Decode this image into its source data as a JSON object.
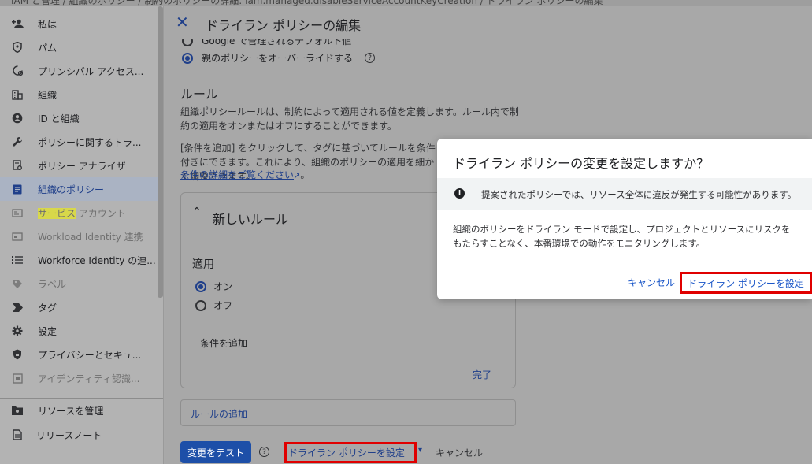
{
  "breadcrumb": "IAM と管理 / 組織のポリシー / 制約のポリシーの詳細: iam.managed.disableServiceAccountKeyCreation / ドライラン ポリシーの編集",
  "sidebar": {
    "items": [
      {
        "label": "私は",
        "icon": "person-add-icon"
      },
      {
        "label": "パム",
        "icon": "shield-icon"
      },
      {
        "label": "プリンシパル アクセス...",
        "icon": "access-icon"
      },
      {
        "label": "組織",
        "icon": "building-icon"
      },
      {
        "label": "ID と組織",
        "icon": "account-circle-icon"
      },
      {
        "label": "ポリシーに関するトラ...",
        "icon": "wrench-icon"
      },
      {
        "label": "ポリシー アナライザ",
        "icon": "analyzer-icon"
      },
      {
        "label": "組織のポリシー",
        "icon": "document-icon"
      },
      {
        "label_highlight": "サービス",
        "label_rest": " アカウント",
        "icon": "service-account-icon"
      },
      {
        "label": "Workload Identity 連携",
        "icon": "workload-icon"
      },
      {
        "label": "Workforce Identity の連...",
        "icon": "list-icon"
      },
      {
        "label": "ラベル",
        "icon": "tag-icon"
      },
      {
        "label": "タグ",
        "icon": "chevron-tag-icon"
      },
      {
        "label": "設定",
        "icon": "gear-icon"
      },
      {
        "label": "プライバシーとセキュ...",
        "icon": "shield-lock-icon"
      },
      {
        "label": "アイデンティティ認識...",
        "icon": "grid-icon"
      }
    ],
    "bottom": [
      {
        "label": "リソースを管理",
        "icon": "folder-gear-icon"
      },
      {
        "label": "リリースノート",
        "icon": "notes-icon"
      }
    ]
  },
  "header": {
    "title": "ドライラン ポリシーの編集"
  },
  "policy_source": {
    "option_google": "Google で管理されるデフォルト値",
    "option_override": "親のポリシーをオーバーライドする"
  },
  "rules": {
    "heading": "ルール",
    "desc": "組織ポリシールールは、制約によって適用される値を定義します。ルール内で制約の適用をオンまたはオフにすることができます。",
    "conditions_text": "[条件を追加] をクリックして、タグに基づいてルールを条件付きにできます。これにより、組織のポリシーの適用を細かく調整できます。",
    "conditions_link": "条件の詳細をご覧ください"
  },
  "new_rule": {
    "title": "新しいルール",
    "enforce_label": "適用",
    "on": "オン",
    "off": "オフ",
    "add_condition": "条件を追加",
    "done": "完了"
  },
  "add_rule": "ルールの追加",
  "footer": {
    "test": "変更をテスト",
    "dry_run": "ドライラン ポリシーを設定",
    "cancel": "キャンセル"
  },
  "dialog": {
    "title": "ドライラン ポリシーの変更を設定しますか？",
    "warning": "提案されたポリシーでは、リソース全体に違反が発生する可能性があります。",
    "body": "組織のポリシーをドライラン モードで設定し、プロジェクトとリソースにリスクをもたらすことなく、本番環境での動作をモニタリングします。",
    "cancel": "キャンセル",
    "confirm": "ドライラン ポリシーを設定"
  },
  "colors": {
    "accent": "#1a56c8",
    "highlight_box": "#e00000"
  }
}
